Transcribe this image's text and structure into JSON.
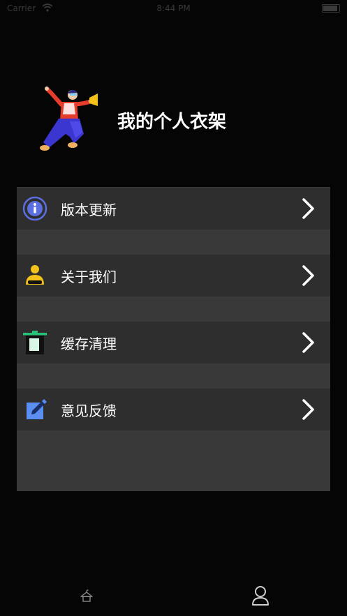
{
  "status_bar": {
    "carrier": "Carrier",
    "time": "8:44 PM",
    "icons": [
      "wifi-icon",
      "battery-icon"
    ]
  },
  "profile": {
    "title": "我的个人衣架",
    "avatar_icon": "dancing-person-illustration"
  },
  "menu": {
    "items": [
      {
        "label": "版本更新",
        "icon": "info-icon"
      },
      {
        "label": "关于我们",
        "icon": "person-icon"
      },
      {
        "label": "缓存清理",
        "icon": "trash-icon"
      },
      {
        "label": "意见反馈",
        "icon": "edit-icon"
      }
    ],
    "chevron_icon": "chevron-right-icon"
  },
  "tab_bar": {
    "tabs": [
      {
        "name": "wardrobe",
        "icon": "hanger-icon",
        "selected": false
      },
      {
        "name": "profile",
        "icon": "user-icon",
        "selected": true
      }
    ]
  },
  "colors": {
    "background": "#060506",
    "panel": "#3a393a",
    "row": "#2f2e2f",
    "text": "#ffffff",
    "info_blue": "#5b6fe0",
    "person_yellow": "#f2c21a",
    "trash_green": "#27c27a",
    "edit_blue": "#5a8ef0"
  }
}
